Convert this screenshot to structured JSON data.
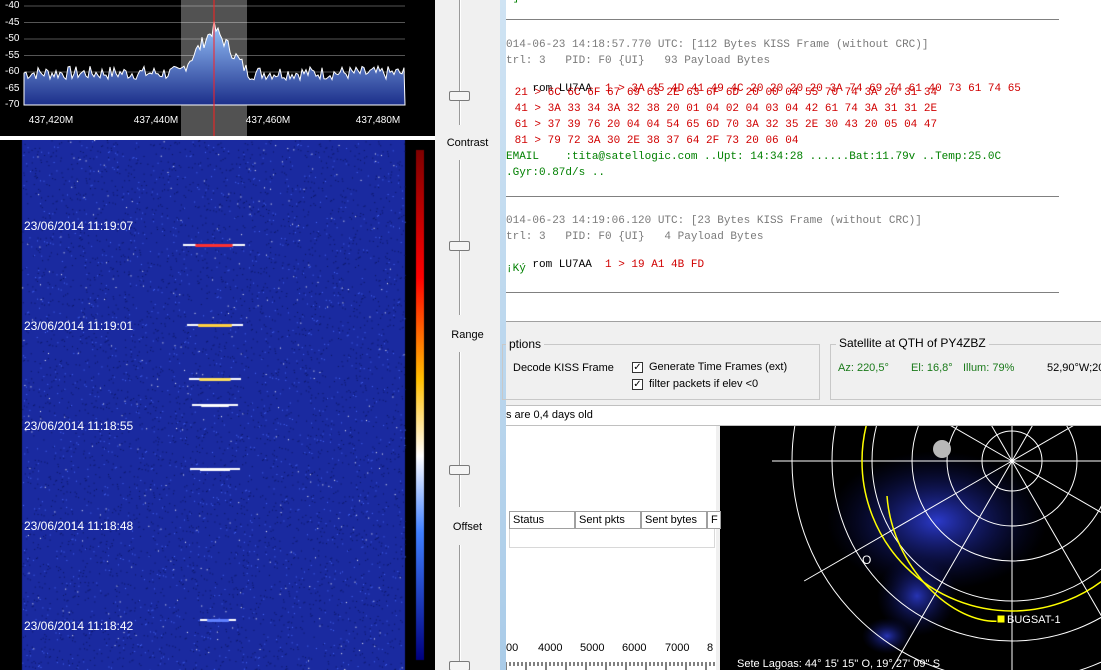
{
  "spectrum": {
    "db_labels": [
      "-40",
      "-45",
      "-50",
      "-55",
      "-60",
      "-65",
      "-70"
    ],
    "freq_labels": [
      "437,420M",
      "437,440M",
      "437,460M",
      "437,480M"
    ]
  },
  "waterfall": {
    "times": [
      "23/06/2014 11:19:07",
      "23/06/2014 11:19:01",
      "23/06/2014 11:18:55",
      "23/06/2014 11:18:48",
      "23/06/2014 11:18:42"
    ]
  },
  "sliders": {
    "contrast_label": "Contrast",
    "range_label": "Range",
    "offset_label": "Offset"
  },
  "log": {
    "top_fragment": "v]",
    "frame1_header": "014-06-23 14:18:57.770 UTC: [112 Bytes KISS Frame (without CRC)]",
    "frame1_ctrl": "trl: 3   PID: F0 {UI}   93 Payload Bytes",
    "frame1_from": "rom LU7AA",
    "frame1_hex": [
      "  1 > 3A 45 4D 41 49 4C 20 20 20 20 3A 74 69 74 61 40 73 61 74 65",
      " 21 > 6C 6C 6F 67 69 63 2E 63 6F 6D 20 00 04 55 70 74 3A 20 31 34",
      " 41 > 3A 33 34 3A 32 38 20 01 04 02 04 03 04 42 61 74 3A 31 31 2E",
      " 61 > 37 39 76 20 04 04 54 65 6D 70 3A 32 35 2E 30 43 20 05 04 47",
      " 81 > 79 72 3A 30 2E 38 37 64 2F 73 20 06 04"
    ],
    "frame1_ascii": [
      "EMAIL    :tita@satellogic.com ..Upt: 14:34:28 ......Bat:11.79v ..Temp:25.0C",
      ".Gyr:0.87d/s .."
    ],
    "frame2_header": "014-06-23 14:19:06.120 UTC: [23 Bytes KISS Frame (without CRC)]",
    "frame2_ctrl": "trl: 3   PID: F0 {UI}   4 Payload Bytes",
    "frame2_from": "rom LU7AA",
    "frame2_hex": "  1 > 19 A1 4B FD",
    "frame2_ascii": "¡Ký"
  },
  "options": {
    "group_title": "ptions",
    "decode_kiss": "Decode KISS Frame",
    "generate_time_frames": "Generate Time Frames (ext)",
    "filter_packets": "filter packets if elev <0",
    "check_mark": "✓"
  },
  "satellite": {
    "title": "Satellite at QTH of PY4ZBZ",
    "az": "Az: 220,5°",
    "el": "El: 16,8°",
    "illum": "Illum: 79%",
    "pos": "52,90°W;20"
  },
  "status": {
    "age_text": "s are 0,4 days old"
  },
  "table": {
    "headers": [
      "Status",
      "Sent pkts",
      "Sent bytes",
      "F"
    ]
  },
  "ruler": {
    "labels": [
      "00",
      "4000",
      "5000",
      "6000",
      "7000",
      "8"
    ]
  },
  "polar": {
    "west_label": "O",
    "sat_label": "BUGSAT-1",
    "location": "Sete Lagoas: 44° 15' 15'' O, 19° 27' 09'' S"
  },
  "colors": {
    "hex_red": "#d00000",
    "ascii_green": "#008000",
    "sat_green": "#1a7a1a",
    "waterfall_blue": "#1a2aa0"
  }
}
